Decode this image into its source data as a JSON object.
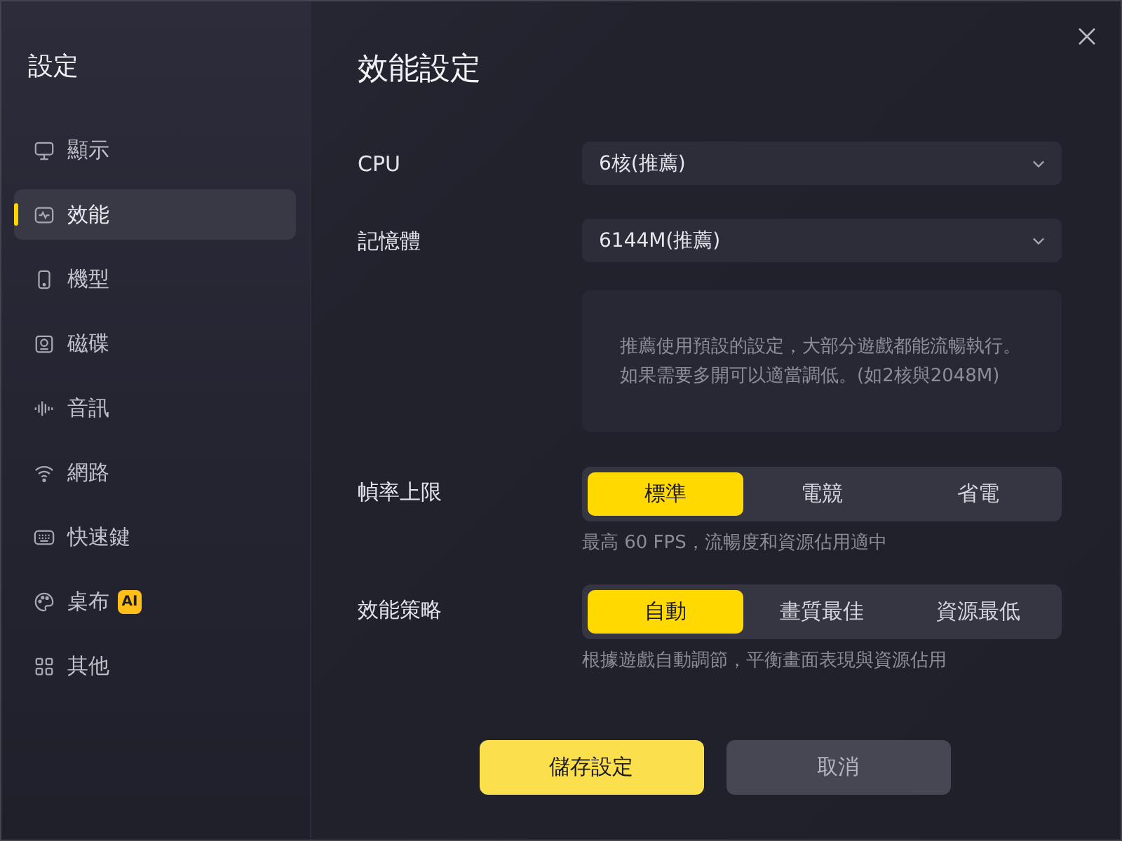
{
  "sidebar": {
    "title": "設定",
    "items": [
      {
        "label": "顯示",
        "selected": false
      },
      {
        "label": "效能",
        "selected": true
      },
      {
        "label": "機型",
        "selected": false
      },
      {
        "label": "磁碟",
        "selected": false
      },
      {
        "label": "音訊",
        "selected": false
      },
      {
        "label": "網路",
        "selected": false
      },
      {
        "label": "快速鍵",
        "selected": false
      },
      {
        "label": "桌布",
        "selected": false,
        "badge": "AI"
      },
      {
        "label": "其他",
        "selected": false
      }
    ]
  },
  "main": {
    "title": "效能設定",
    "settings": [
      {
        "kind": "dropdown",
        "label": "CPU",
        "value": "6核(推薦)"
      },
      {
        "kind": "dropdown",
        "label": "記憶體",
        "value": "6144M(推薦)"
      },
      {
        "kind": "note",
        "lines": [
          "推薦使用預設的設定，大部分遊戲都能流暢執行。",
          "如果需要多開可以適當調低。(如2核與2048M)"
        ]
      },
      {
        "kind": "segmented",
        "label": "幀率上限",
        "options": [
          {
            "label": "標準",
            "selected": true
          },
          {
            "label": "電競",
            "selected": false
          },
          {
            "label": "省電",
            "selected": false
          }
        ],
        "hint": "最高 60 FPS，流暢度和資源佔用適中"
      },
      {
        "kind": "segmented",
        "label": "效能策略",
        "options": [
          {
            "label": "自動",
            "selected": true
          },
          {
            "label": "畫質最佳",
            "selected": false
          },
          {
            "label": "資源最低",
            "selected": false
          }
        ],
        "hint": "根據遊戲自動調節，平衡畫面表現與資源佔用"
      }
    ],
    "buttons": [
      {
        "kind": "primary",
        "label": "儲存設定"
      },
      {
        "kind": "secondary",
        "label": "取消"
      }
    ]
  }
}
